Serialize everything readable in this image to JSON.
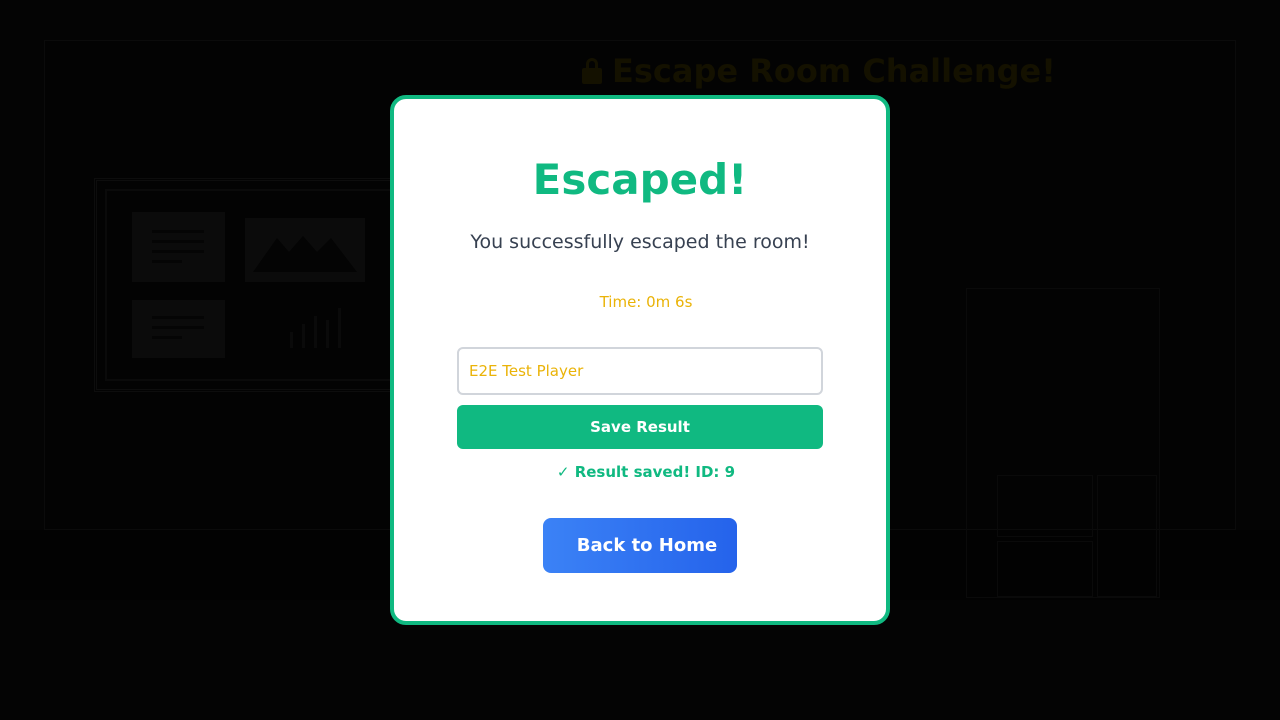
{
  "background": {
    "title": "Escape Room Challenge!",
    "title_icon": "lock-icon"
  },
  "modal": {
    "title": "Escaped!",
    "message": "You successfully escaped the room!",
    "time": "Time: 0m 6s",
    "name_input_value": "E2E Test Player",
    "save_button_label": "Save Result",
    "saved_status": "✓ Result saved! ID: 9",
    "home_button_label": "Back to Home"
  },
  "colors": {
    "success": "#10b981",
    "highlight": "#eab308",
    "primary": "#3b82f6"
  }
}
